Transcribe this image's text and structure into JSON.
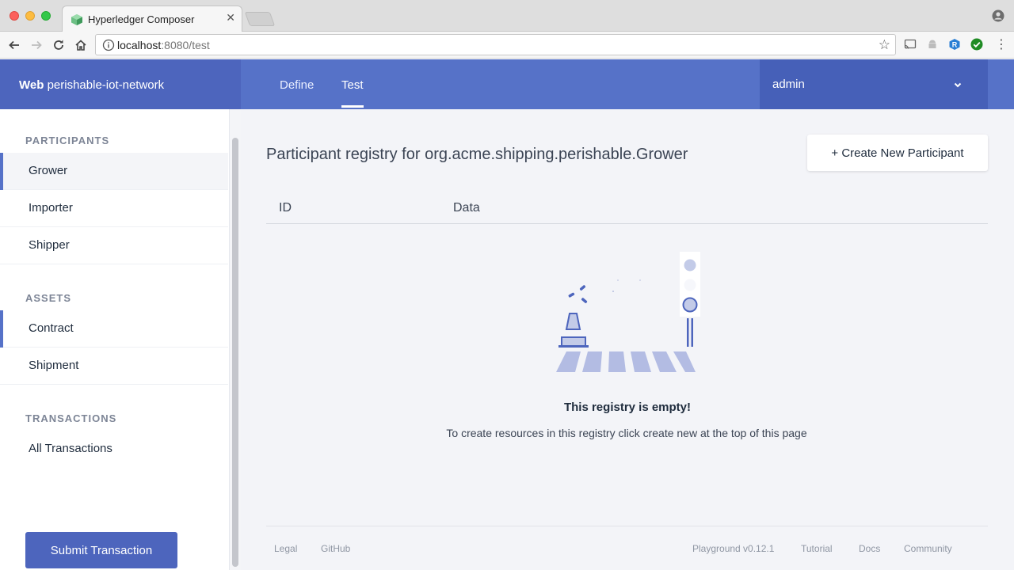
{
  "browser": {
    "tab_title": "Hyperledger Composer",
    "url_host": "localhost",
    "url_rest": ":8080/test"
  },
  "header": {
    "brand_bold": "Web",
    "brand_name": "perishable-iot-network",
    "nav": [
      "Define",
      "Test"
    ],
    "active_nav": "Test",
    "user": "admin"
  },
  "sidebar": {
    "participants_heading": "PARTICIPANTS",
    "participants": [
      "Grower",
      "Importer",
      "Shipper"
    ],
    "assets_heading": "ASSETS",
    "assets": [
      "Contract",
      "Shipment"
    ],
    "transactions_heading": "TRANSACTIONS",
    "transactions": [
      "All Transactions"
    ],
    "submit_label": "Submit Transaction"
  },
  "main": {
    "title": "Participant registry for org.acme.shipping.perishable.Grower",
    "create_label": "+ Create New Participant",
    "columns": [
      "ID",
      "Data"
    ],
    "empty_title": "This registry is empty!",
    "empty_text": "To create resources in this registry click create new at the top of this page"
  },
  "footer": {
    "left": [
      "Legal",
      "GitHub"
    ],
    "version": "Playground v0.12.1",
    "right": [
      "Tutorial",
      "Docs",
      "Community"
    ]
  },
  "colors": {
    "header": "#5672c8",
    "brand_bg": "#4d65bd",
    "accent": "#5672c8",
    "main_bg": "#f3f4f8"
  }
}
